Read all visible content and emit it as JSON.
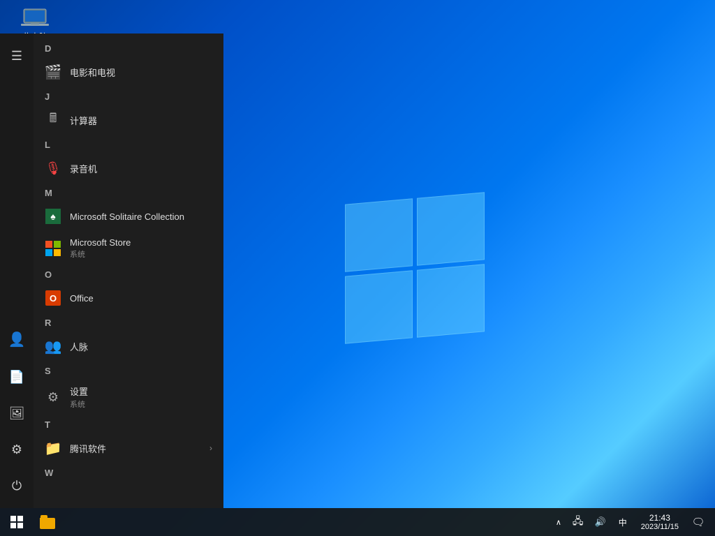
{
  "desktop": {
    "icon_label": "此电脑"
  },
  "start_menu": {
    "hamburger_label": "☰",
    "sections": [
      {
        "letter": "D",
        "apps": [
          {
            "id": "movie",
            "name": "电影和电视",
            "sub": "",
            "icon_type": "movie"
          }
        ]
      },
      {
        "letter": "J",
        "apps": [
          {
            "id": "calculator",
            "name": "计算器",
            "sub": "",
            "icon_type": "calculator"
          }
        ]
      },
      {
        "letter": "L",
        "apps": [
          {
            "id": "recorder",
            "name": "录音机",
            "sub": "",
            "icon_type": "recorder"
          }
        ]
      },
      {
        "letter": "M",
        "apps": [
          {
            "id": "solitaire",
            "name": "Microsoft Solitaire Collection",
            "sub": "",
            "icon_type": "solitaire"
          },
          {
            "id": "store",
            "name": "Microsoft Store",
            "sub": "系统",
            "icon_type": "store"
          }
        ]
      },
      {
        "letter": "O",
        "apps": [
          {
            "id": "office",
            "name": "Office",
            "sub": "",
            "icon_type": "office"
          }
        ]
      },
      {
        "letter": "R",
        "apps": [
          {
            "id": "people",
            "name": "人脉",
            "sub": "",
            "icon_type": "people"
          }
        ]
      },
      {
        "letter": "S",
        "apps": [
          {
            "id": "settings",
            "name": "设置",
            "sub": "系统",
            "icon_type": "settings"
          }
        ]
      },
      {
        "letter": "T",
        "apps": [
          {
            "id": "tencent",
            "name": "腾讯软件",
            "sub": "",
            "icon_type": "folder",
            "has_chevron": true
          }
        ]
      },
      {
        "letter": "W",
        "apps": []
      }
    ]
  },
  "sidebar": {
    "items": [
      {
        "id": "avatar",
        "icon": "👤",
        "label": "avatar"
      },
      {
        "id": "docs",
        "icon": "📄",
        "label": "documents"
      },
      {
        "id": "photos",
        "icon": "🖼",
        "label": "photos"
      },
      {
        "id": "settings",
        "icon": "⚙",
        "label": "settings"
      },
      {
        "id": "power",
        "icon": "⏻",
        "label": "power"
      }
    ]
  },
  "taskbar": {
    "start_icon": "⊞",
    "clock": {
      "time": "21:43",
      "date": "2023/11/15"
    },
    "tray": {
      "chevron": "∧",
      "network": "□",
      "volume": "🔊",
      "lang": "中"
    },
    "notification_icon": "□"
  }
}
